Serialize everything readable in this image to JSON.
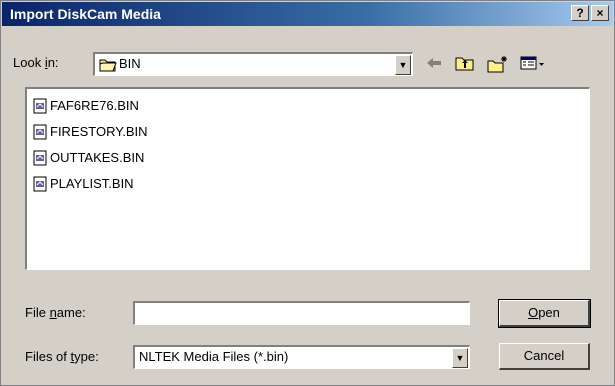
{
  "window": {
    "title": "Import DiskCam Media",
    "help_glyph": "?",
    "close_glyph": "×"
  },
  "lookin": {
    "label_pre": "Look ",
    "label_accel": "i",
    "label_post": "n:",
    "value": "BIN"
  },
  "toolbar": [
    "back-arrow-icon",
    "up-folder-icon",
    "new-folder-icon",
    "view-menu-icon"
  ],
  "files": [
    {
      "name": "FAF6RE76.BIN"
    },
    {
      "name": "FIRESTORY.BIN"
    },
    {
      "name": "OUTTAKES.BIN"
    },
    {
      "name": "PLAYLIST.BIN"
    }
  ],
  "filename": {
    "label_pre": "File ",
    "label_accel": "n",
    "label_post": "ame:",
    "value": ""
  },
  "filetype": {
    "label_pre": "Files of ",
    "label_accel": "t",
    "label_post": "ype:",
    "value": "NLTEK Media Files (*.bin)"
  },
  "buttons": {
    "open_accel": "O",
    "open_rest": "pen",
    "cancel": "Cancel"
  },
  "colors": {
    "titlebar_start": "#0a246a",
    "titlebar_end": "#a6caf0",
    "dialog_bg": "#d4d0c8"
  }
}
